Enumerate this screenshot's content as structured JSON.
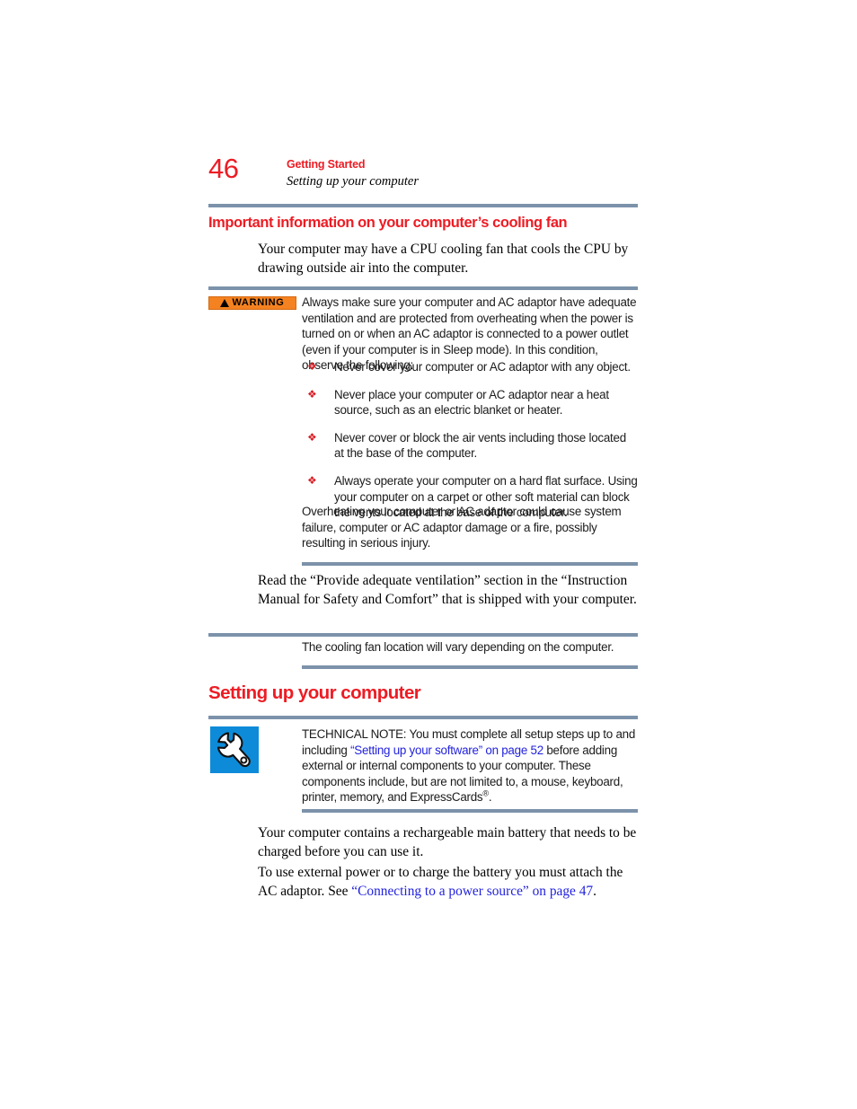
{
  "page": {
    "folio": "46",
    "running_head": {
      "chapter": "Getting Started",
      "section": "Setting up your computer"
    },
    "accent_red": "#ed1c24",
    "rule_color": "#7c92aa",
    "link_blue": "#2222dd",
    "warning_orange": "#f58220",
    "icon_blue": "#0d8bd9"
  },
  "subhead": "Important information on your computer’s cooling fan",
  "intro_paragraph": "Your computer may have a CPU cooling fan that cools the CPU by drawing outside air into the computer.",
  "warning": {
    "badge_label": "WARNING",
    "badge_icon": "warning-triangle-icon",
    "lead": "Always make sure your computer and AC adaptor have adequate ventilation and are protected from overheating when the power is turned on or when an AC adaptor is connected to a power outlet (even if your computer is in Sleep mode). In this condition, observe the following:",
    "bullet_glyph": "❖",
    "bullets": [
      "Never cover your computer or AC adaptor with any object.",
      "Never place your computer or AC adaptor near a heat source, such as an electric blanket or heater.",
      "Never cover or block the air vents including those located at the base of the computer.",
      "Always operate your computer on a hard flat surface. Using your computer on a carpet or other soft material can block the vents located at the base of the computer."
    ],
    "tail": "Overheating your computer or AC adaptor could cause system failure, computer or AC adaptor damage or a fire, possibly resulting in serious injury."
  },
  "read_paragraph": "Read the “Provide adequate ventilation” section in the “Instruction Manual for Safety and Comfort” that is shipped with your computer.",
  "note": {
    "text": "The cooling fan location will vary depending on the computer."
  },
  "main_heading": "Setting up your computer",
  "technical_note": {
    "icon": "wrench-icon",
    "text_before_link": "TECHNICAL NOTE: You must complete all setup steps up to and including ",
    "link": "“Setting up your software” on page 52",
    "text_after_link": " before adding external or internal components to your computer. These components include, but are not limited to, a mouse, keyboard, printer, memory, and ExpressCards",
    "registered_mark": "®",
    "text_end": "."
  },
  "battery_paragraph": "Your computer contains a rechargeable main battery that needs to be charged before you can use it.",
  "power_paragraph": {
    "before_link": "To use external power or to charge the battery you must attach the AC adaptor. See ",
    "link": "“Connecting to a power source” on page 47",
    "after_link": "."
  }
}
